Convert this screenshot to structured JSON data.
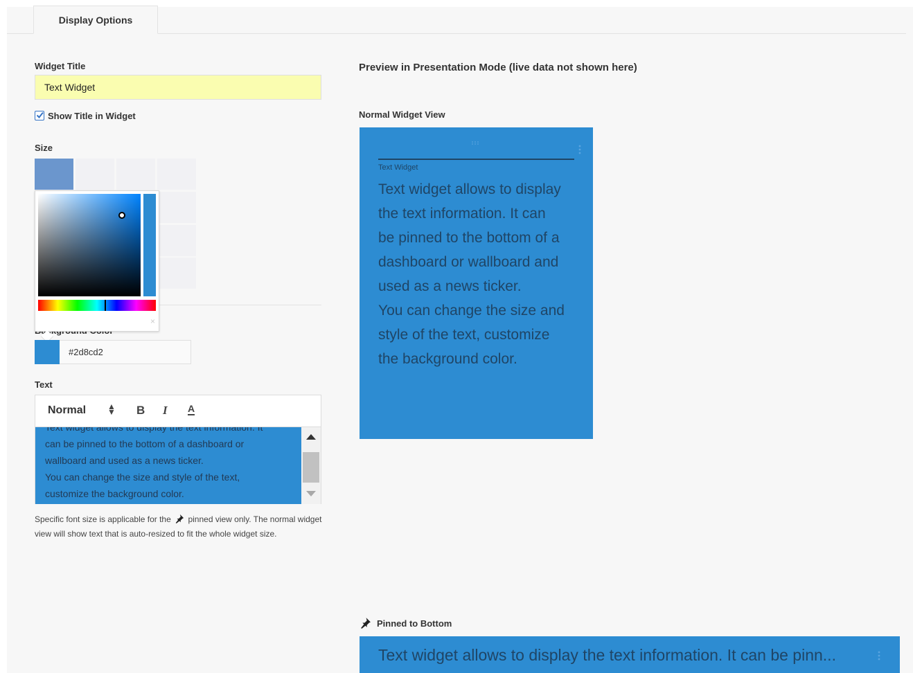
{
  "tabs": [
    {
      "label": "Display Options"
    }
  ],
  "form": {
    "widget_title_label": "Widget Title",
    "widget_title_value": "Text Widget",
    "show_title_label": "Show Title in Widget",
    "show_title_checked": true,
    "size_label": "Size",
    "background_color_label": "Background Color",
    "background_color_value": "#2d8cd2",
    "text_label": "Text",
    "editor": {
      "format_value": "Normal",
      "bold_label": "B",
      "italic_label": "I",
      "color_label": "A",
      "content_lines": [
        "Text widget allows to display the text information. It",
        "can be pinned to the bottom of a dashboard or",
        "wallboard and used as a news ticker.",
        "You can change the size and style of the text,",
        "customize the background color."
      ]
    },
    "hint_part1": "Specific font size is applicable for the",
    "hint_part2": "pinned view only. The normal widget view will show text that is auto-resized to fit the whole widget size."
  },
  "color_picker": {
    "close_icon": "×"
  },
  "preview": {
    "title": "Preview in Presentation Mode (live data not shown here)",
    "normal_view_label": "Normal Widget View",
    "widget_title": "Text Widget",
    "widget_body_lines": [
      "Text widget allows to display",
      "the text information. It can",
      "be pinned to the bottom of a",
      "dashboard or wallboard and",
      "used as a news ticker.",
      "You can change the size and",
      "style of the text, customize",
      "the background color."
    ],
    "pinned_label": "Pinned to Bottom",
    "pinned_text": "Text widget allows to display the text information. It can be pinn..."
  },
  "colors": {
    "widget_bg": "#2d8cd2",
    "title_input_bg": "#fafdb0",
    "selected_size": "#6b96cd",
    "accent": "#3473c5"
  },
  "icons": {
    "checkbox": "checkbox-checked-icon",
    "pin": "pin-icon",
    "drag": "drag-handle-icon",
    "menu": "vertical-dots-icon"
  }
}
